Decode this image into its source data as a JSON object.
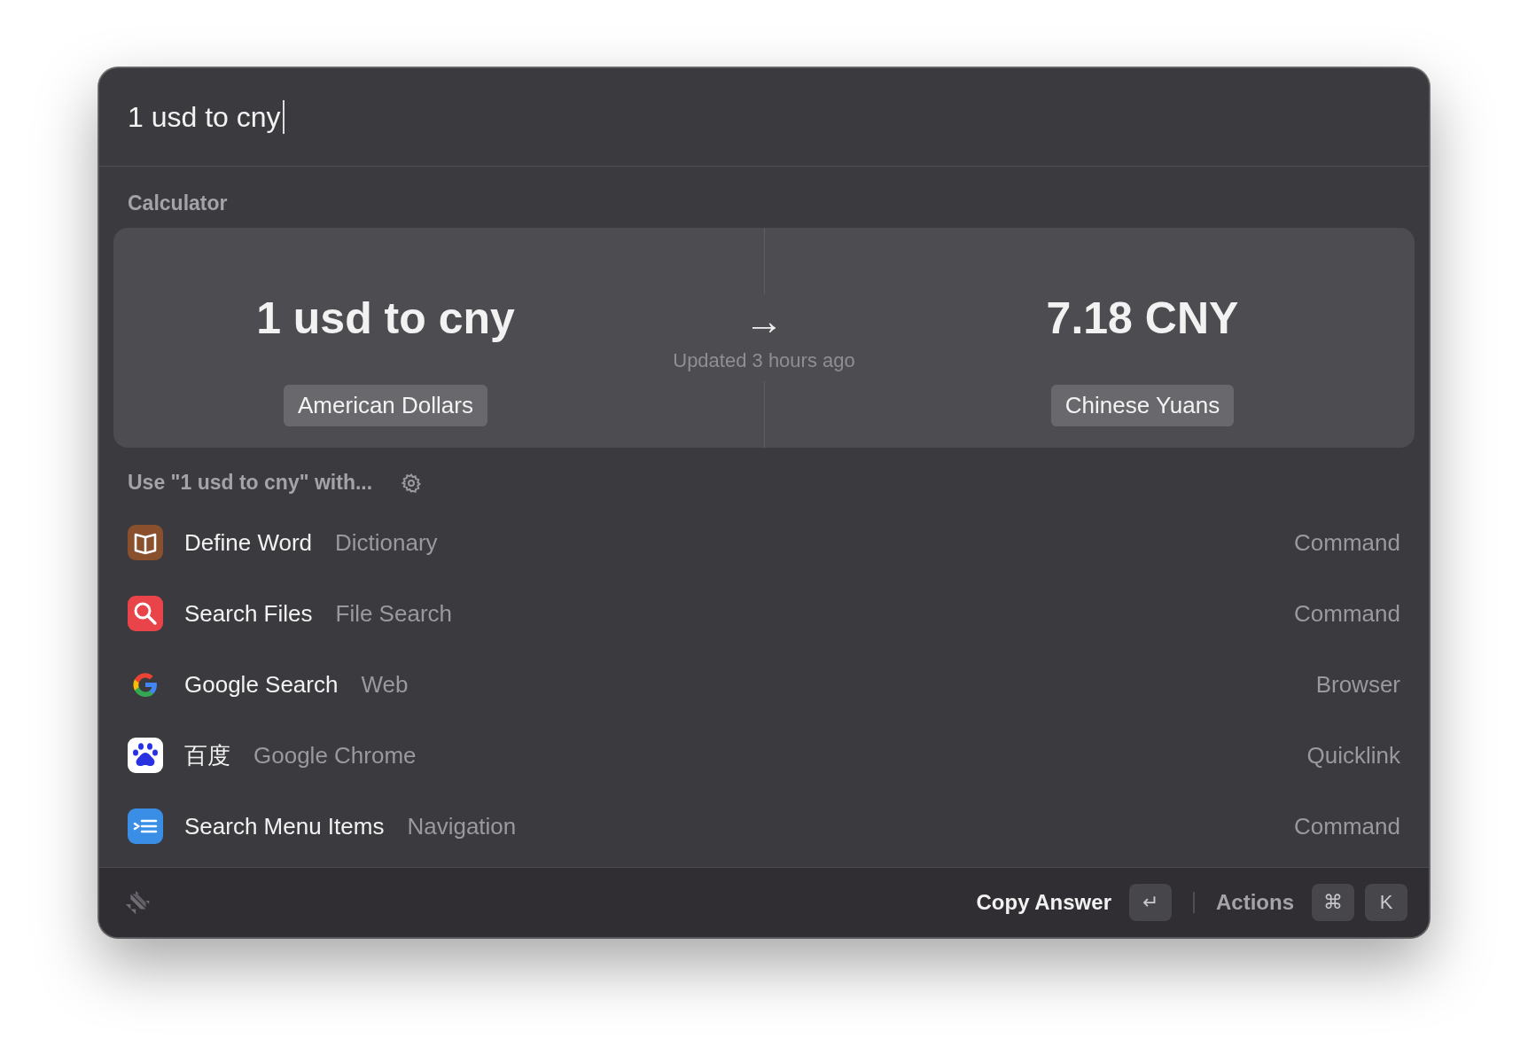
{
  "search": {
    "value": "1 usd to cny"
  },
  "calculator": {
    "section_title": "Calculator",
    "query": "1 usd to cny",
    "arrow": "→",
    "result": "7.18 CNY",
    "updated": "Updated 3 hours ago",
    "from_unit": "American Dollars",
    "to_unit": "Chinese Yuans"
  },
  "use_with": {
    "title": "Use \"1 usd to cny\" with..."
  },
  "items": [
    {
      "kind": "dictionary",
      "title": "Define Word",
      "subtitle": "Dictionary",
      "type": "Command"
    },
    {
      "kind": "file-search",
      "title": "Search Files",
      "subtitle": "File Search",
      "type": "Command"
    },
    {
      "kind": "google",
      "title": "Google Search",
      "subtitle": "Web",
      "type": "Browser"
    },
    {
      "kind": "baidu",
      "title": "百度",
      "subtitle": "Google Chrome",
      "type": "Quicklink"
    },
    {
      "kind": "menu",
      "title": "Search Menu Items",
      "subtitle": "Navigation",
      "type": "Command"
    }
  ],
  "footer": {
    "primary_action": "Copy Answer",
    "primary_key": "↵",
    "actions": "Actions",
    "action_keys": [
      "⌘",
      "K"
    ]
  }
}
